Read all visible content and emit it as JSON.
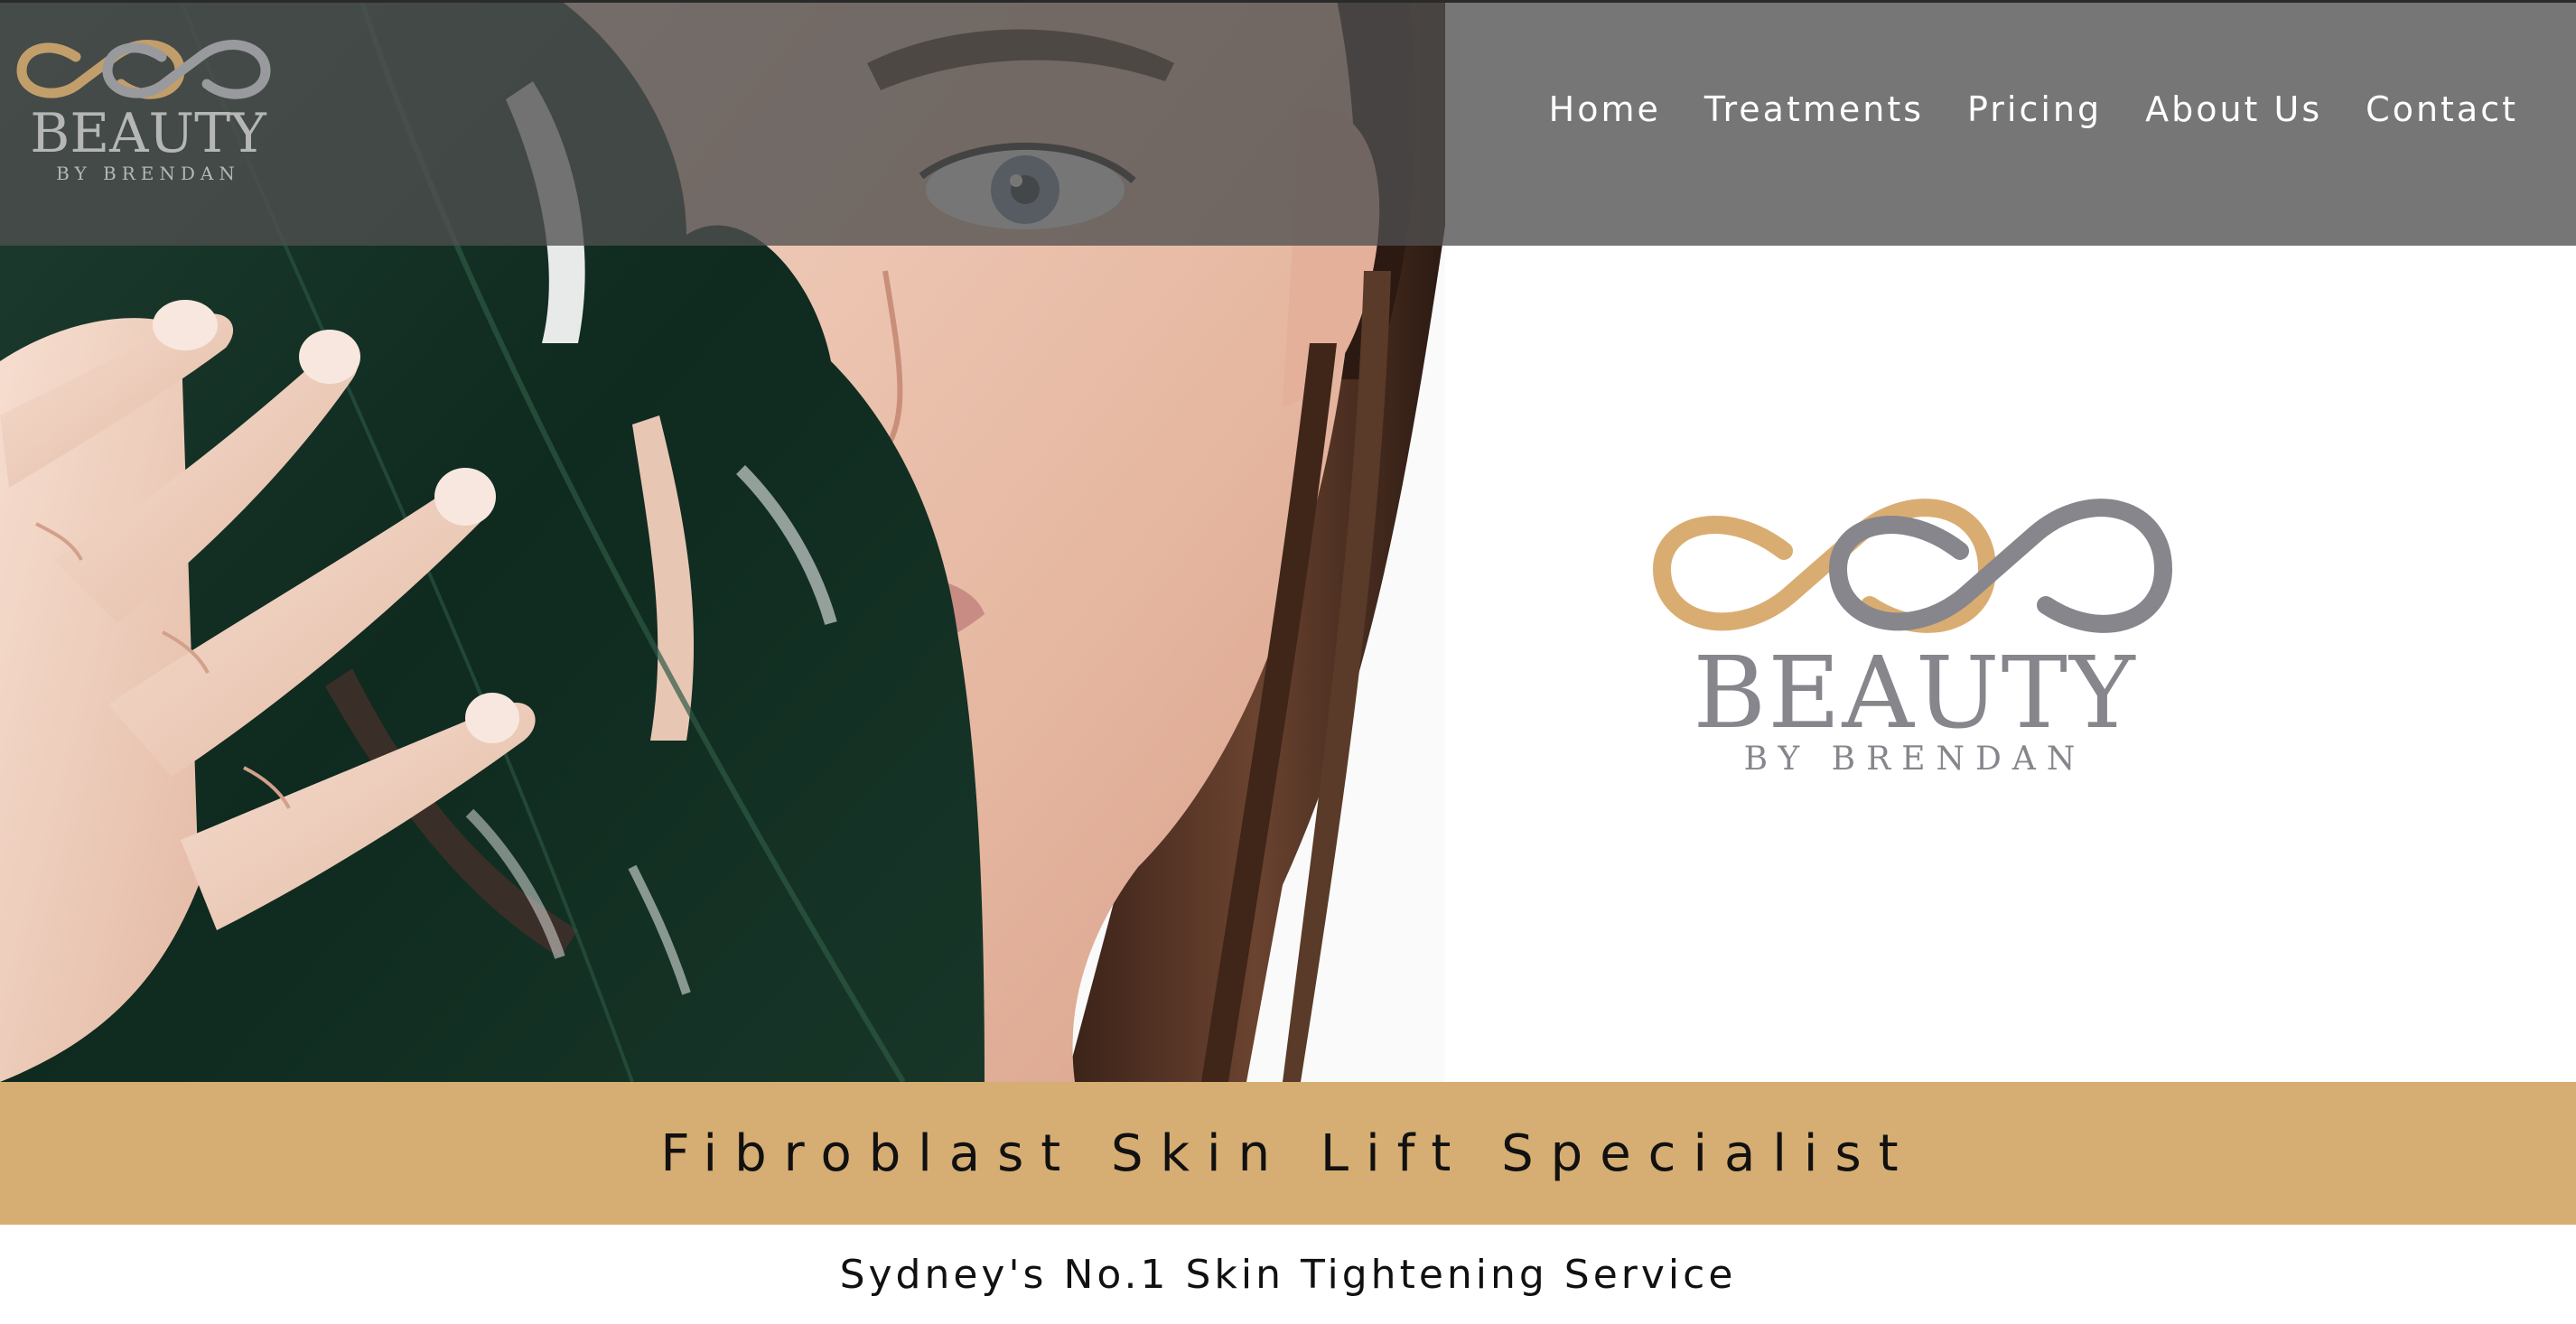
{
  "header": {
    "logo": {
      "word": "BEAUTY",
      "tagline": "BY BRENDAN"
    },
    "nav": [
      {
        "label": "Home"
      },
      {
        "label": "Treatments"
      },
      {
        "label": "Pricing"
      },
      {
        "label": "About Us"
      },
      {
        "label": "Contact"
      }
    ]
  },
  "hero": {
    "logo": {
      "word": "BEAUTY",
      "tagline": "BY BRENDAN"
    },
    "image": "woman-with-monstera-leaf-photo"
  },
  "banner": {
    "title": "Fibroblast Skin Lift Specialist"
  },
  "subtitle": "Sydney's No.1 Skin Tightening Service",
  "colors": {
    "gold": "#d6ad72",
    "logo_gold": "#d9ad72",
    "logo_grey": "#86868c",
    "header_overlay": "#505050",
    "text_dark": "#111111"
  }
}
